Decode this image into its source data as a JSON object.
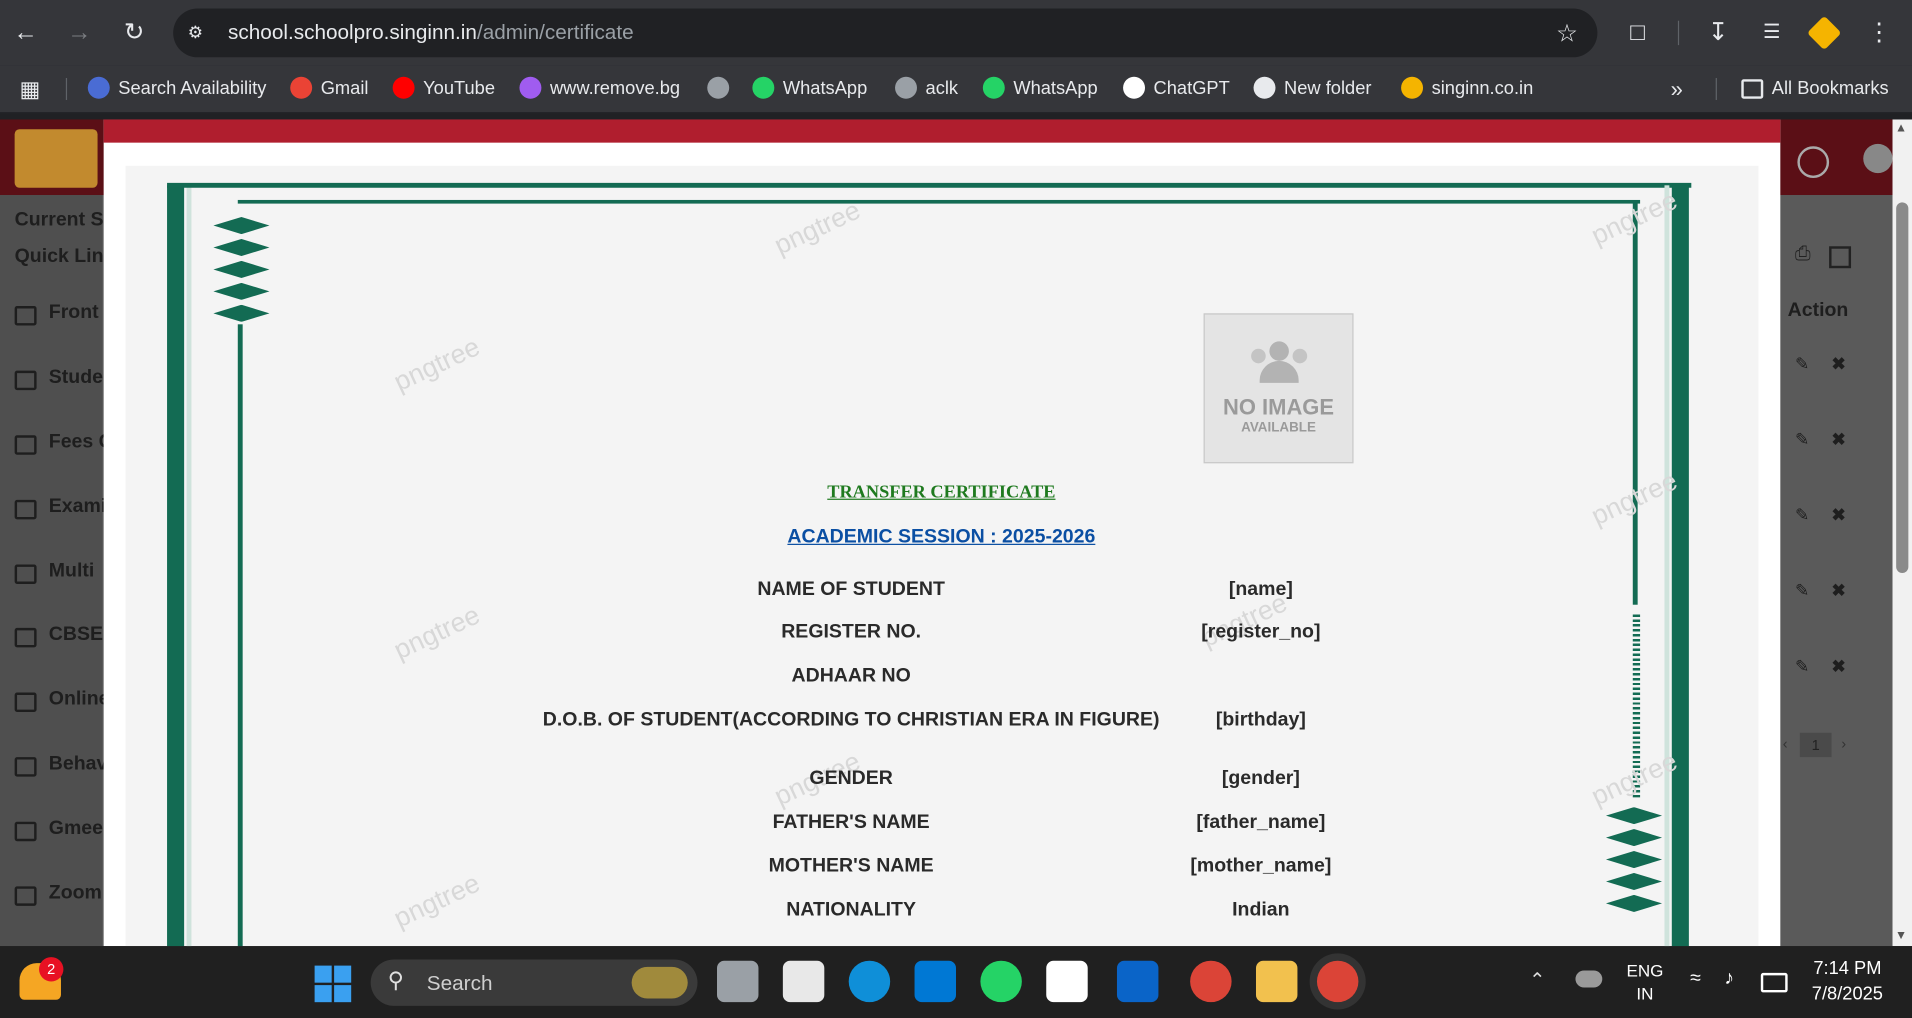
{
  "browser": {
    "url_host": "school.schoolpro.singinn.in",
    "url_path": "/admin/certificate",
    "bookmarks": [
      {
        "label": "Search Availability",
        "icon": "site-icon",
        "color": "#4a6cd4"
      },
      {
        "label": "Gmail",
        "icon": "gmail-icon",
        "color": "#ea4335"
      },
      {
        "label": "YouTube",
        "icon": "youtube-icon",
        "color": "#ff0000"
      },
      {
        "label": "www.remove.bg",
        "icon": "removebg-icon",
        "color": "#a05cf0"
      },
      {
        "label": "",
        "icon": "globe-icon",
        "color": "#9aa0a6"
      },
      {
        "label": "WhatsApp",
        "icon": "whatsapp-icon",
        "color": "#25d366"
      },
      {
        "label": "aclk",
        "icon": "globe-icon",
        "color": "#9aa0a6"
      },
      {
        "label": "WhatsApp",
        "icon": "whatsapp-icon",
        "color": "#25d366"
      },
      {
        "label": "ChatGPT",
        "icon": "chatgpt-icon",
        "color": "#ffffff"
      },
      {
        "label": "New folder",
        "icon": "folder-icon",
        "color": "#e8eaed"
      },
      {
        "label": "singinn.co.in",
        "icon": "singinn-icon",
        "color": "#f5b400"
      }
    ],
    "all_bookmarks": "All Bookmarks"
  },
  "sidebar": {
    "items": [
      "Current Se",
      "Quick Lin",
      "Front",
      "Stude",
      "Fees C",
      "Exami",
      "Multi",
      "CBSE",
      "Online",
      "Behav",
      "Gmee",
      "Zoom"
    ]
  },
  "right_panel": {
    "action_header": "Action",
    "page_number": "1"
  },
  "certificate": {
    "title": "TRANSFER CERTIFICATE",
    "session": "ACADEMIC SESSION : 2025-2026",
    "photo_placeholder_line1": "NO IMAGE",
    "photo_placeholder_line2": "AVAILABLE",
    "watermark": "pngtree",
    "rows": [
      {
        "label": "NAME OF STUDENT",
        "value": "[name]"
      },
      {
        "label": "REGISTER NO.",
        "value": "[register_no]"
      },
      {
        "label": "ADHAAR NO",
        "value": ""
      },
      {
        "label": "D.O.B. OF STUDENT(ACCORDING TO CHRISTIAN ERA IN FIGURE)",
        "value": "[birthday]"
      },
      {
        "label": "GENDER",
        "value": "[gender]"
      },
      {
        "label": "FATHER'S NAME",
        "value": "[father_name]"
      },
      {
        "label": "MOTHER'S NAME",
        "value": "[mother_name]"
      },
      {
        "label": "NATIONALITY",
        "value": "Indian"
      }
    ]
  },
  "taskbar": {
    "notification_count": "2",
    "search_placeholder": "Search",
    "language_line1": "ENG",
    "language_line2": "IN",
    "time": "7:14 PM",
    "date": "7/8/2025"
  },
  "colors": {
    "accent_red": "#b01e2e",
    "border_green": "#136b53",
    "title_green": "#1f7a1f",
    "session_blue": "#0b4fa3"
  }
}
